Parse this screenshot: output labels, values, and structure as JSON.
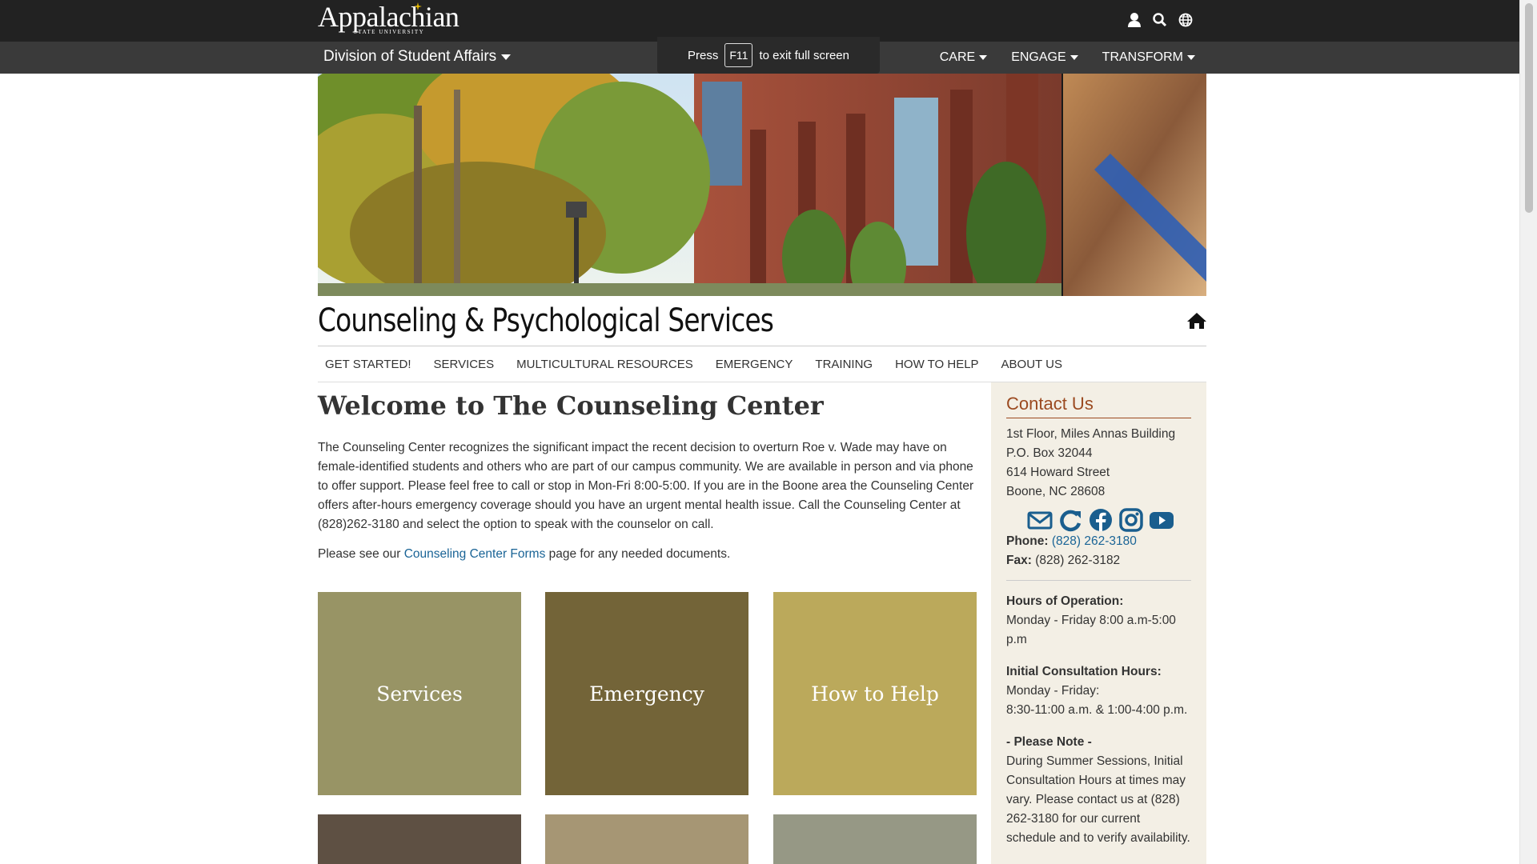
{
  "header": {
    "logo_text": "Appalachian",
    "logo_sub": "STATE UNIVERSITY",
    "icons": [
      "user-icon",
      "search-icon",
      "globe-icon"
    ]
  },
  "division": {
    "title": "Division of Student Affairs",
    "nav": [
      {
        "label": "CARE"
      },
      {
        "label": "ENGAGE"
      },
      {
        "label": "TRANSFORM"
      }
    ]
  },
  "fullscreen_notice": {
    "press": "Press",
    "key": "F11",
    "rest": "to exit full screen"
  },
  "site": {
    "title": "Counseling & Psychological Services",
    "subnav": [
      "GET STARTED!",
      "SERVICES",
      "MULTICULTURAL RESOURCES",
      "EMERGENCY",
      "TRAINING",
      "HOW TO HELP",
      "ABOUT US"
    ]
  },
  "main": {
    "heading": "Welcome to The Counseling Center",
    "intro": "The Counseling Center recognizes the significant impact the recent decision to overturn Roe v. Wade may have on female-identified students and others who are part of our campus community. We are available in person and via phone  to offer support. Please feel free to call or stop in Mon-Fri 8:00-5:00.  If you are in the Boone area the Counseling Center offers after-hours emergency coverage should you have an urgent mental health issue. Call the Counseling Center at (828)262-3180 and select the option to speak with the counselor on call.",
    "forms_before": "Please see our ",
    "forms_link": "Counseling Center Forms",
    "forms_after": " page for any needed documents.",
    "tiles": [
      "Services",
      "Emergency",
      "How to Help"
    ],
    "tile_colors": [
      "#989465",
      "#736438",
      "#bba95b",
      "#5e5043",
      "#a69674",
      "#969885"
    ]
  },
  "sidebar": {
    "heading": "Contact Us",
    "address": [
      "1st Floor, Miles Annas Building",
      "P.O. Box 32044",
      "614 Howard Street",
      "Boone, NC 28608"
    ],
    "social_icons": [
      "email-icon",
      "refresh-icon",
      "facebook-icon",
      "instagram-icon",
      "youtube-icon"
    ],
    "phone_label": "Phone:",
    "phone": "(828) 262-3180",
    "fax_label": "Fax:",
    "fax": "(828) 262-3182",
    "hours_label": "Hours of Operation:",
    "hours": "Monday - Friday 8:00 a.m-5:00 p.m",
    "initial_label": "Initial Consultation Hours:",
    "initial_days": "Monday - Friday:",
    "initial_times": "8:30-11:00 a.m. & 1:00-4:00 p.m.",
    "note_label": "- Please Note -",
    "note": "During Summer Sessions, Initial Consultation Hours at times may vary. Please contact us at (828) 262-3180 for our current schedule and to verify availability."
  },
  "colors": {
    "topbar": "#222222",
    "divbar": "#3a3a3a",
    "contact_heading": "#9b4a20",
    "link": "#1a6496",
    "sidebar_bg": "#f3efe5"
  }
}
